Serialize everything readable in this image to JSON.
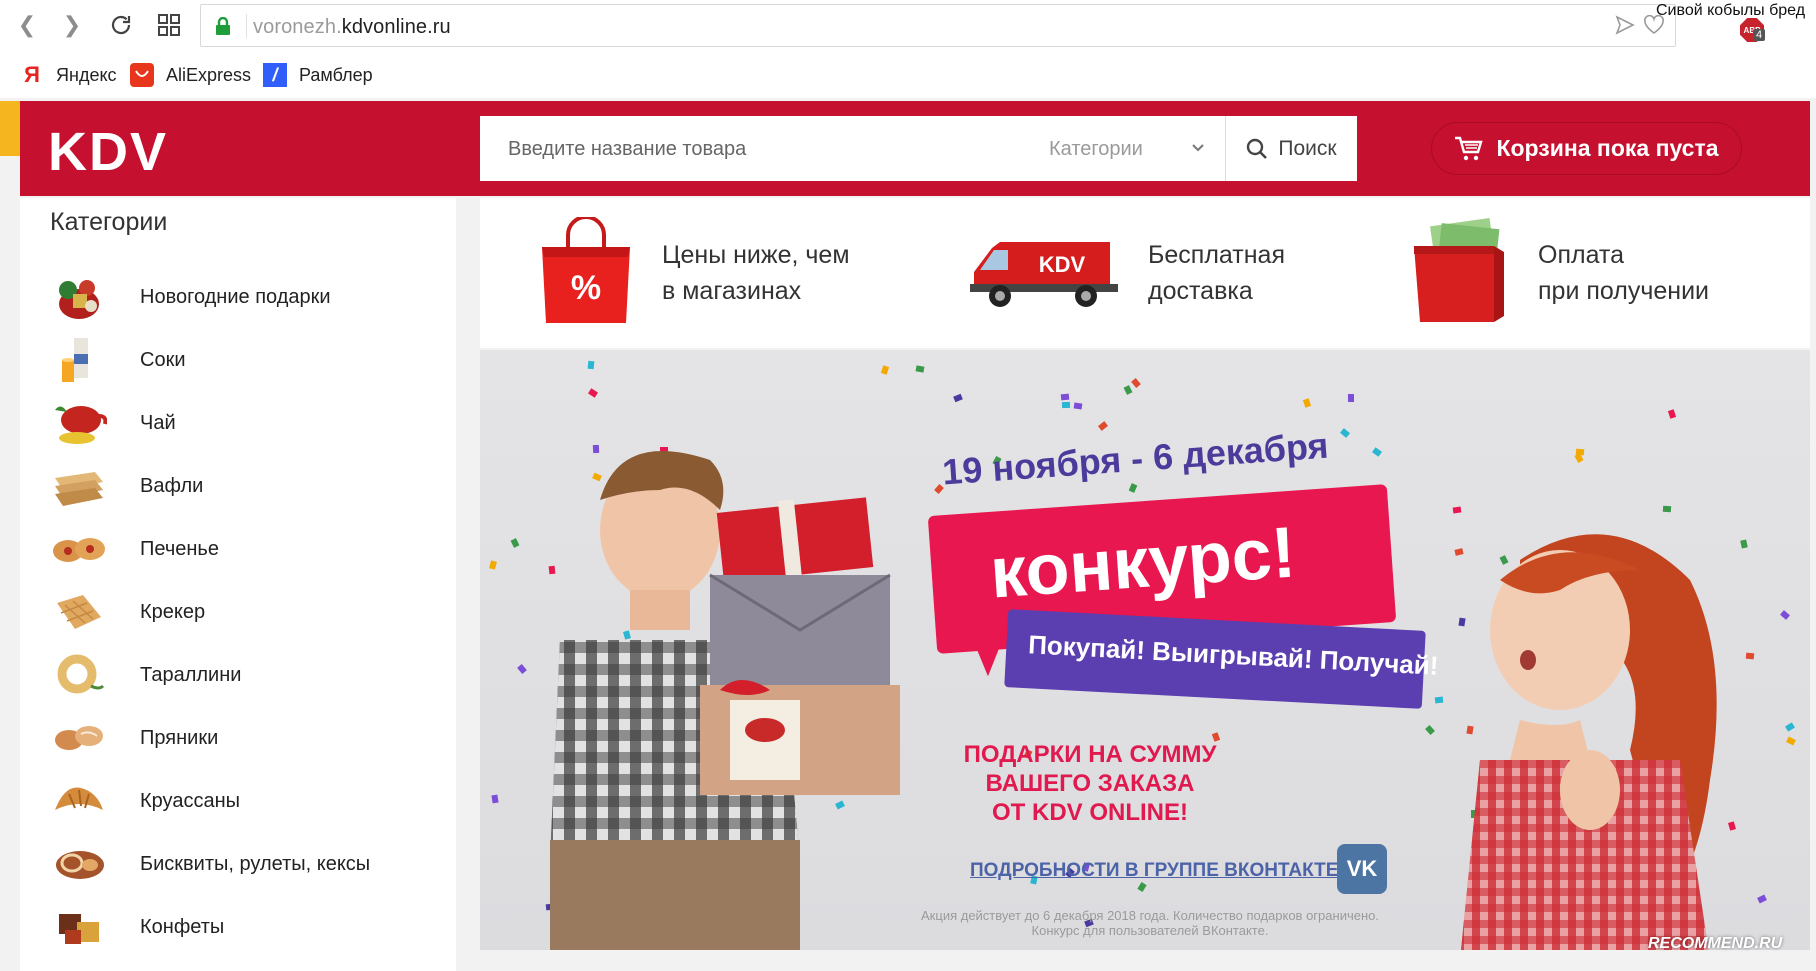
{
  "browser": {
    "url_subdomain": "voronezh.",
    "url_domain": "kdvonline.ru",
    "tab_title": "Сивой кобылы бред",
    "adblock_label": "ABP",
    "adblock_count": "4",
    "bookmarks": [
      {
        "label": "Яндекс",
        "icon": "yandex-icon",
        "glyph": "Я"
      },
      {
        "label": "AliExpress",
        "icon": "aliexpress-icon",
        "glyph": ""
      },
      {
        "label": "Рамблер",
        "icon": "rambler-icon",
        "glyph": "/"
      }
    ]
  },
  "header": {
    "logo": "KDV",
    "search_placeholder": "Введите название товара",
    "category_select": "Категории",
    "search_button": "Поиск",
    "cart_label": "Корзина пока пуста",
    "brand_color": "#c5102f"
  },
  "sidebar": {
    "title": "Категории",
    "items": [
      {
        "label": "Новогодние подарки",
        "icon": "gift-basket-icon"
      },
      {
        "label": "Соки",
        "icon": "juice-icon"
      },
      {
        "label": "Чай",
        "icon": "tea-icon"
      },
      {
        "label": "Вафли",
        "icon": "waffle-icon"
      },
      {
        "label": "Печенье",
        "icon": "cookie-icon"
      },
      {
        "label": "Крекер",
        "icon": "cracker-icon"
      },
      {
        "label": "Тараллини",
        "icon": "tarallini-icon"
      },
      {
        "label": "Пряники",
        "icon": "gingerbread-icon"
      },
      {
        "label": "Круассаны",
        "icon": "croissant-icon"
      },
      {
        "label": "Бисквиты, рулеты, кексы",
        "icon": "sponge-cake-icon"
      },
      {
        "label": "Конфеты",
        "icon": "candy-icon"
      }
    ]
  },
  "features": [
    {
      "line1": "Цены ниже, чем",
      "line2": "в магазинах",
      "icon": "shopping-bag-percent-icon"
    },
    {
      "line1": "Бесплатная",
      "line2": "доставка",
      "icon": "delivery-van-icon",
      "van_text": "KDV"
    },
    {
      "line1": "Оплата",
      "line2": "при получении",
      "icon": "wallet-icon"
    }
  ],
  "banner": {
    "dates": "19 ноября - 6 декабря",
    "headline": "конкурс!",
    "slogan": "Покупай! Выигрывай! Получай!",
    "gifts_line1": "ПОДАРКИ НА СУММУ",
    "gifts_line2": "ВАШЕГО ЗАКАЗА",
    "gifts_line3": "ОТ KDV ONLINE!",
    "vk_link": "ПОДРОБНОСТИ В ГРУППЕ ВКОНТАКТЕ",
    "vk_logo": "VK",
    "disclaimer_line1": "Акция действует до 6 декабря 2018 года. Количество подарков ограничено.",
    "disclaimer_line2": "Конкурс для пользователей ВКонтакте."
  },
  "watermark": "RECOMMEND.RU"
}
